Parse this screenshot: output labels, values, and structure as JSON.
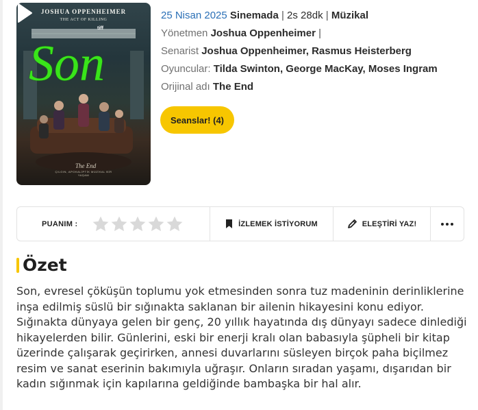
{
  "poster": {
    "director_credit": "JOSHUA OPPENHEIMER",
    "previous_work": "THE ACT OF KILLING",
    "festival_badge": "tiff",
    "title_art": "Son",
    "subtitle_art": "The End",
    "tagline": "ÇILGIN, APOKALİPTİK MÜZİKAL BİR YAŞAM"
  },
  "meta": {
    "release_date": "25 Nisan 2025",
    "release_status": "Sinemada",
    "duration": "2s 28dk",
    "genre": "Müzikal",
    "separator": "|",
    "director_label": "Yönetmen",
    "director": "Joshua Oppenheimer",
    "writer_label": "Senarist",
    "writers": "Joshua Oppenheimer, Rasmus Heisterberg",
    "cast_label": "Oyuncular:",
    "cast": "Tilda Swinton, George MacKay, Moses Ingram",
    "original_title_label": "Orijinal adı",
    "original_title": "The End"
  },
  "actions": {
    "showtimes_button": "Seanslar! (4)"
  },
  "rating_bar": {
    "score_label": "PUANIM :",
    "star_count": 5,
    "filled_stars": 0,
    "watchlist_label": "İZLEMEK İSTİYORUM",
    "review_label": "ELEŞTİRİ YAZ!"
  },
  "summary": {
    "heading": "Özet",
    "text": "Son, evresel çöküşün toplumu yok etmesinden sonra tuz madeninin derinliklerine inşa edilmiş süslü bir sığınakta saklanan bir ailenin hikayesini konu ediyor. Sığınakta dünyaya gelen bir genç, 20 yıllık hayatında dış dünyayı sadece dinlediği hikayelerden bilir. Günlerini, eski bir enerji kralı olan babasıyla şüpheli bir kitap üzerinde çalışarak geçirirken, annesi duvarlarını süsleyen birçok paha biçilmez resim ve sanat eserinin bakımıyla uğraşır. Onların sıradan yaşamı, dışarıdan bir kadın sığınmak için kapılarına geldiğinde bambaşka bir hal alır."
  },
  "colors": {
    "accent_yellow": "#f7c600",
    "link_blue": "#2a6fb6",
    "star_empty": "#d9d9d9",
    "poster_title_green": "#39e51a"
  },
  "icons": {
    "play": "play-icon",
    "star": "star-icon",
    "watchlist": "bookmark-icon",
    "review": "pen-icon",
    "more": "more-dots-icon"
  }
}
